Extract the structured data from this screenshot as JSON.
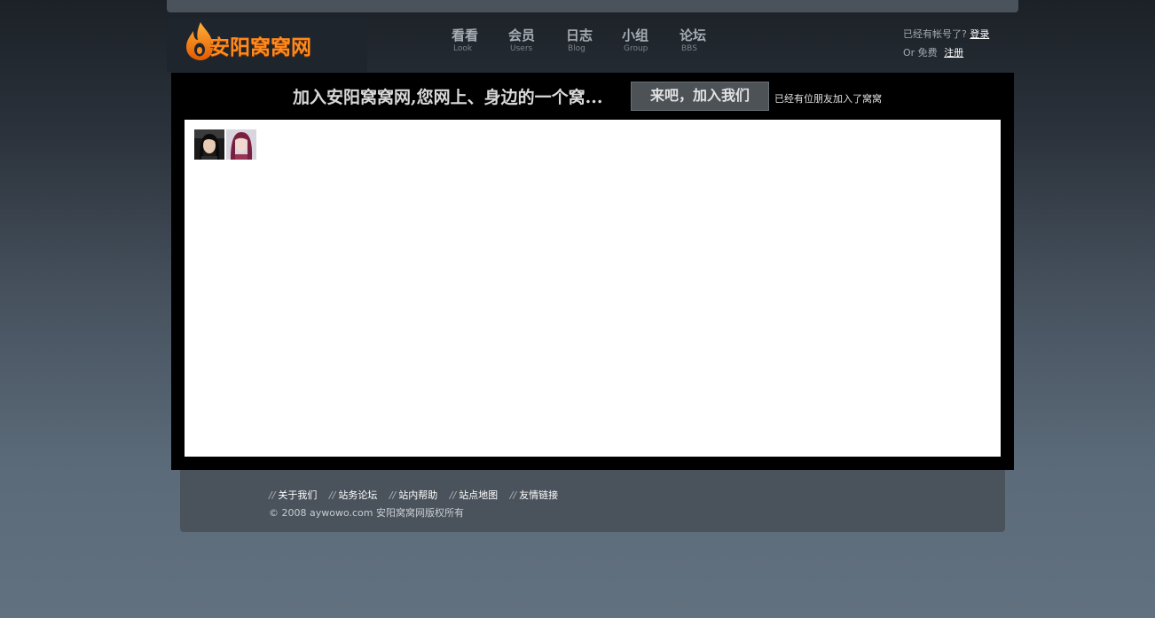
{
  "site": {
    "name": "安阳窝窝网"
  },
  "nav": [
    {
      "zh": "看看",
      "en": "Look"
    },
    {
      "zh": "会员",
      "en": "Users"
    },
    {
      "zh": "日志",
      "en": "Blog"
    },
    {
      "zh": "小组",
      "en": "Group"
    },
    {
      "zh": "论坛",
      "en": "BBS"
    }
  ],
  "account": {
    "prompt": "已经有帐号了?",
    "login": "登录",
    "or_free": "Or 免费",
    "register": "注册"
  },
  "banner": {
    "headline": "加入安阳窝窝网,您网上、身边的一个窝...",
    "join_button": "来吧，加入我们",
    "joined_note": "已经有位朋友加入了窝窝"
  },
  "footer": {
    "links": [
      "关于我们",
      "站务论坛",
      "站内帮助",
      "站点地图",
      "友情链接"
    ],
    "copyright": "© 2008 aywowo.com 安阳窝窝网版权所有"
  },
  "colors": {
    "logo_orange": "#ff8a1c",
    "panel_black": "#000000",
    "footer_gray": "#4a525b"
  }
}
